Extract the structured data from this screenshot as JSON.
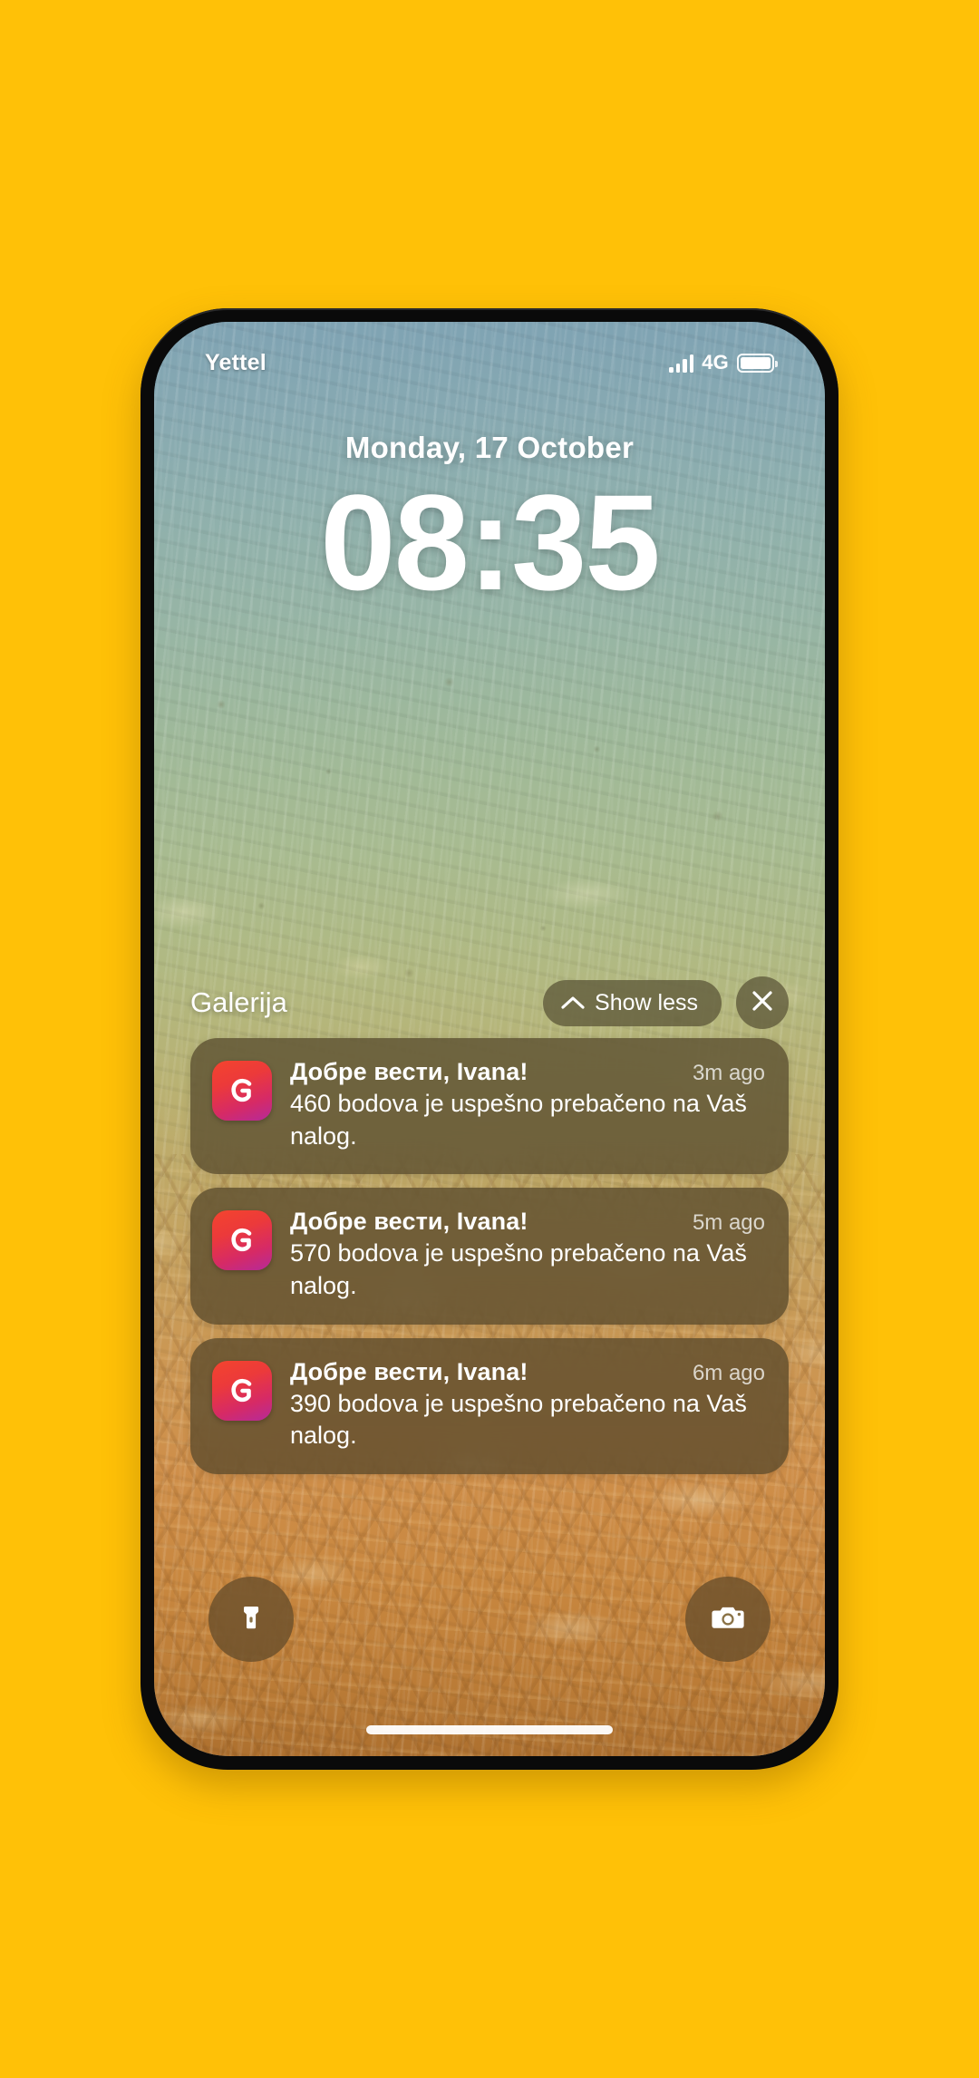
{
  "background": {
    "color": "#FFC107"
  },
  "device": {
    "frame_color": "#0a0a0a"
  },
  "status_bar": {
    "carrier": "Yettel",
    "network_type": "4G",
    "signal_icon": "signal-bars-icon",
    "battery_icon": "battery-full-icon"
  },
  "lock_screen": {
    "date": "Monday, 17 October",
    "time": "08:35"
  },
  "notification_group": {
    "title": "Galerija",
    "show_less_label": "Show less",
    "chevron_icon": "chevron-up-icon",
    "close_icon": "close-icon"
  },
  "notifications": [
    {
      "app_icon": "galerija-app-icon",
      "title": "Добре вести, Ivana!",
      "message": "460 bodova je uspešno prebačeno na Vaš nalog.",
      "time": "3m ago"
    },
    {
      "app_icon": "galerija-app-icon",
      "title": "Добре вести, Ivana!",
      "message": "570 bodova je uspešno prebačeno na Vaš nalog.",
      "time": "5m ago"
    },
    {
      "app_icon": "galerija-app-icon",
      "title": "Добре вести, Ivana!",
      "message": "390 bodova je uspešno prebačeno na Vaš nalog.",
      "time": "6m ago"
    }
  ],
  "shortcuts": {
    "flashlight_icon": "flashlight-icon",
    "camera_icon": "camera-icon"
  },
  "home_indicator": {
    "present": true
  }
}
